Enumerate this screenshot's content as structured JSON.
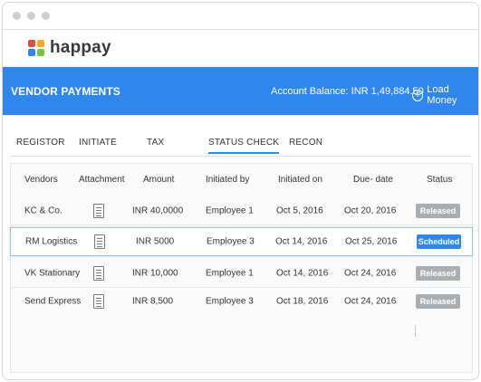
{
  "brand": {
    "name": "happay"
  },
  "banner": {
    "title": "VENDOR PAYMENTS",
    "balance": "Account Balance: INR 1,49,884.50",
    "load_money": "Load Money"
  },
  "tabs": [
    {
      "label": "REGISTOR"
    },
    {
      "label": "INITIATE"
    },
    {
      "label": "TAX"
    },
    {
      "label": "STATUS CHECK",
      "active": true
    },
    {
      "label": "RECON"
    }
  ],
  "table": {
    "headers": [
      "Vendors",
      "Attachment",
      "Amount",
      "Initiated by",
      "Initiated on",
      "Due- date",
      "Status"
    ],
    "rows": [
      {
        "vendor": "KC & Co.",
        "amount": "INR 40,0000",
        "initiated_by": "Employee 1",
        "initiated_on": "Oct 5, 2016",
        "due_date": "Oct 20, 2016",
        "status": "Released"
      },
      {
        "vendor": "RM Logistics",
        "amount": "INR 5000",
        "initiated_by": "Employee 3",
        "initiated_on": "Oct 14, 2016",
        "due_date": "Oct 25, 2016",
        "status": "Scheduled"
      },
      {
        "vendor": "VK Stationary",
        "amount": "INR 10,000",
        "initiated_by": "Employee 1",
        "initiated_on": "Oct 14, 2016",
        "due_date": "Oct 24, 2016",
        "status": "Released"
      },
      {
        "vendor": "Send Express",
        "amount": "INR 8,500",
        "initiated_by": "Employee 3",
        "initiated_on": "Oct 18, 2016",
        "due_date": "Oct 24, 2016",
        "status": "Released"
      }
    ]
  },
  "colors": {
    "accent": "#2f86ec",
    "released_badge": "#a9aeb3",
    "scheduled_badge": "#2f86ec",
    "logo": [
      "#e8483f",
      "#f5a623",
      "#2f86ec",
      "#7ac142"
    ]
  },
  "icons": {
    "attachment": "document-icon",
    "load_money": "plus-circle-icon"
  }
}
